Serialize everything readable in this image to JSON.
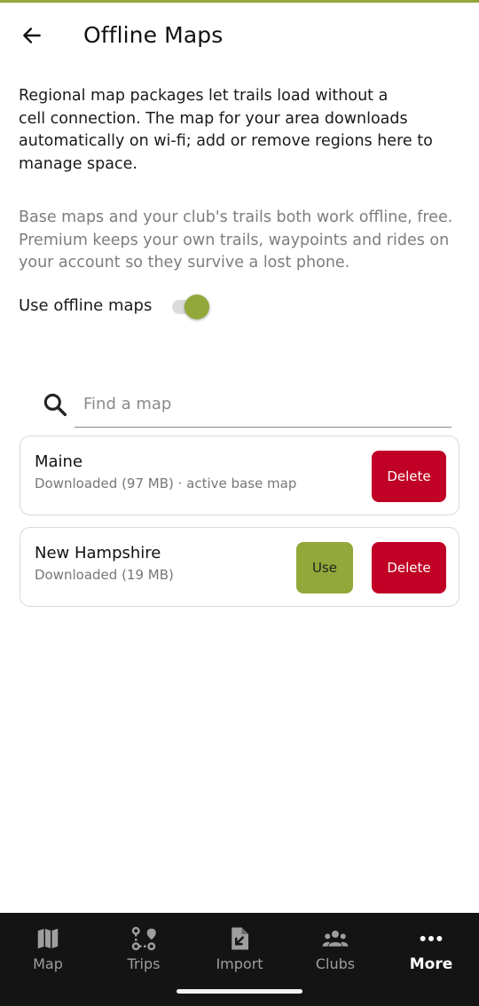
{
  "header": {
    "title": "Offline Maps"
  },
  "intro_lines": [
    "Regional map packages let trails load without a",
    "cell connection. The map for your area downloads",
    "automatically on wi-fi; add or remove regions here to",
    "manage space."
  ],
  "note_lines": [
    "Base maps and your club's trails both work offline, free.",
    "Premium keeps your own trails, waypoints and rides on",
    "your account so they survive a lost phone."
  ],
  "toggle": {
    "label": "Use offline maps",
    "on": true
  },
  "search": {
    "placeholder": "Find a map",
    "value": ""
  },
  "maps": [
    {
      "name": "Maine",
      "status": "Downloaded (97 MB) · active base map",
      "delete_label": "Delete"
    },
    {
      "name": "New Hampshire",
      "status": "Downloaded (19 MB)",
      "use_label": "Use",
      "delete_label": "Delete"
    }
  ],
  "nav": [
    {
      "label": "Map",
      "icon": "map-icon"
    },
    {
      "label": "Trips",
      "icon": "route-icon"
    },
    {
      "label": "Import",
      "icon": "import-file-icon"
    },
    {
      "label": "Clubs",
      "icon": "group-icon"
    },
    {
      "label": "More",
      "icon": "more-dots-icon",
      "active": true
    }
  ],
  "colors": {
    "accent": "#93a83a",
    "danger": "#c00024",
    "nav_bg": "#141414"
  }
}
